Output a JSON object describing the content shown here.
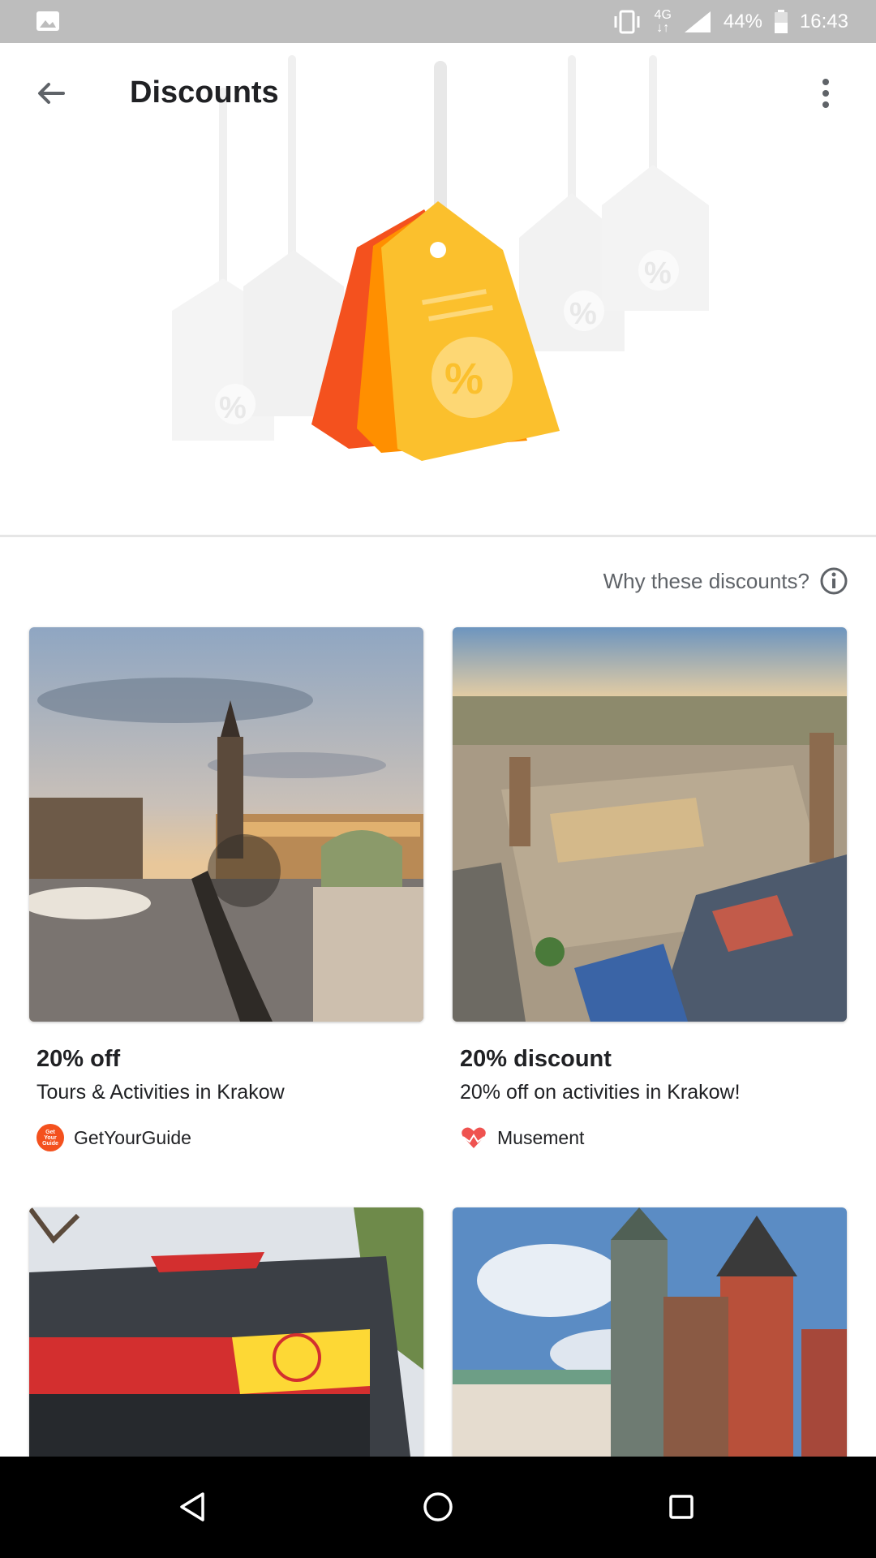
{
  "status_bar": {
    "network": "4G",
    "battery": "44%",
    "time": "16:43",
    "icons": [
      "image-icon",
      "vibrate-icon",
      "signal-icon",
      "battery-icon"
    ]
  },
  "app_bar": {
    "title": "Discounts",
    "back_icon": "arrow-back-icon",
    "menu_icon": "more-vert-icon"
  },
  "hero": {
    "illustration": "discount-tags-illustration",
    "tag_symbol": "%"
  },
  "why_link": "Why these discounts?",
  "cards": [
    {
      "headline": "20% off",
      "subtitle": "Tours & Activities in Krakow",
      "provider": "GetYourGuide",
      "logo_text": "Get Your Guide",
      "image": "krakow-market-square-dusk"
    },
    {
      "headline": "20% discount",
      "subtitle": "20% off on activities in Krakow!",
      "provider": "Musement",
      "image": "krakow-aerial-square"
    },
    {
      "image": "hop-on-hop-off-bus"
    },
    {
      "image": "wawel-cathedral-towers"
    }
  ],
  "nav_bar": {
    "icons": [
      "back-triangle-icon",
      "home-circle-icon",
      "recents-square-icon"
    ]
  },
  "colors": {
    "accent_orange": "#f4511e",
    "tag_yellow": "#fbc02d",
    "status_bar": "#bdbdbd"
  }
}
